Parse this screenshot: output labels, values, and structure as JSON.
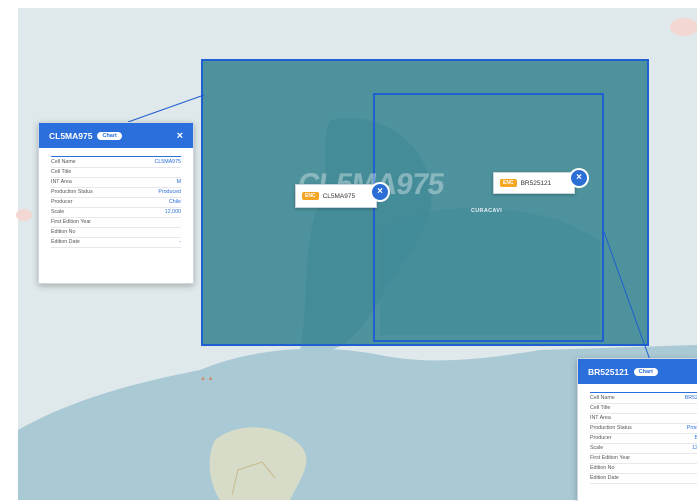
{
  "map": {
    "colors": {
      "land": "#dfe8ea",
      "water": "#a9c9d4",
      "selection_fill": "#2e7f8c",
      "selection_stroke": "#1f5fd0",
      "accent": "#2a6fdb",
      "badge": "#f5a623"
    },
    "background_label": "CL5MA975",
    "place_label": "CURACAVI",
    "charts": [
      {
        "name": "CL5MA975",
        "badge": "ENC",
        "close": "×"
      },
      {
        "name": "BR525121",
        "badge": "ENC",
        "close": "×"
      }
    ]
  },
  "cards": [
    {
      "title": "CL5MA975",
      "pill": "Chart",
      "close": "×",
      "rows": [
        {
          "key": "Cell Name",
          "value": "CL5MA975"
        },
        {
          "key": "Cell Title",
          "value": ""
        },
        {
          "key": "INT Area",
          "value": "M"
        },
        {
          "key": "Production Status",
          "value": "Produced"
        },
        {
          "key": "Producer",
          "value": "Chile"
        },
        {
          "key": "Scale",
          "value": "12,000"
        },
        {
          "key": "First Edition Year",
          "value": ""
        },
        {
          "key": "Edition No",
          "value": ""
        },
        {
          "key": "Edition Date",
          "value": "-"
        }
      ]
    },
    {
      "title": "BR525121",
      "pill": "Chart",
      "close": "×",
      "rows": [
        {
          "key": "Cell Name",
          "value": "BR52"
        },
        {
          "key": "Cell Title",
          "value": ""
        },
        {
          "key": "INT Area",
          "value": ""
        },
        {
          "key": "Production Status",
          "value": "Prod"
        },
        {
          "key": "Producer",
          "value": "B"
        },
        {
          "key": "Scale",
          "value": "12"
        },
        {
          "key": "First Edition Year",
          "value": ""
        },
        {
          "key": "Edition No",
          "value": ""
        },
        {
          "key": "Edition Date",
          "value": ""
        }
      ]
    }
  ]
}
